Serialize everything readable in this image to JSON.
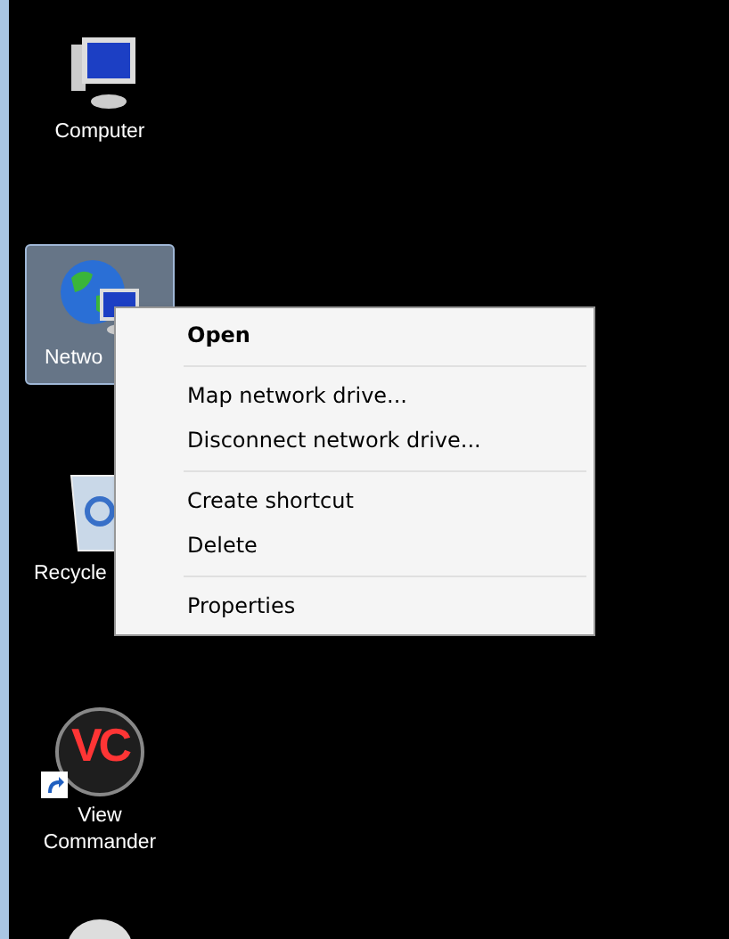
{
  "desktop_icons": [
    {
      "kind": "computer",
      "label": "Computer",
      "selected": false
    },
    {
      "kind": "network",
      "label": "Netwo",
      "selected": true
    },
    {
      "kind": "recycle",
      "label": "Recycle",
      "selected": false
    },
    {
      "kind": "app",
      "label": "View Commander",
      "logo_text": "VC",
      "shortcut": true,
      "selected": false
    },
    {
      "kind": "partial",
      "selected": false
    }
  ],
  "context_menu": {
    "items": [
      {
        "kind": "item",
        "label": "Open",
        "default": true
      },
      {
        "kind": "separator"
      },
      {
        "kind": "item",
        "label": "Map network drive...",
        "default": false
      },
      {
        "kind": "item",
        "label": "Disconnect network drive...",
        "default": false
      },
      {
        "kind": "separator"
      },
      {
        "kind": "item",
        "label": "Create shortcut",
        "default": false
      },
      {
        "kind": "item",
        "label": "Delete",
        "default": false
      },
      {
        "kind": "separator"
      },
      {
        "kind": "item",
        "label": "Properties",
        "default": false
      }
    ]
  }
}
